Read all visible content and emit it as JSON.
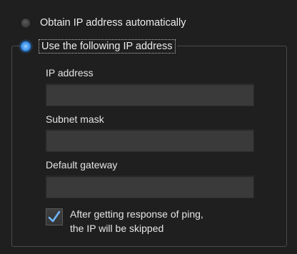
{
  "radios": {
    "auto_label": "Obtain IP address automatically",
    "manual_label": "Use the following IP address",
    "selected": "manual"
  },
  "fields": {
    "ip_label": "IP address",
    "ip_value": "",
    "subnet_label": "Subnet mask",
    "subnet_value": "",
    "gateway_label": "Default gateway",
    "gateway_value": ""
  },
  "checkbox": {
    "checked": true,
    "line1": "After getting response of ping,",
    "line2": "the IP will be skipped"
  },
  "colors": {
    "background": "#1f1f1f",
    "radio_selected": "#4a9ef0",
    "check_mark": "#6fb6ff",
    "input_background": "#3a3a3a"
  },
  "icons": {
    "check": "checkmark-icon"
  }
}
